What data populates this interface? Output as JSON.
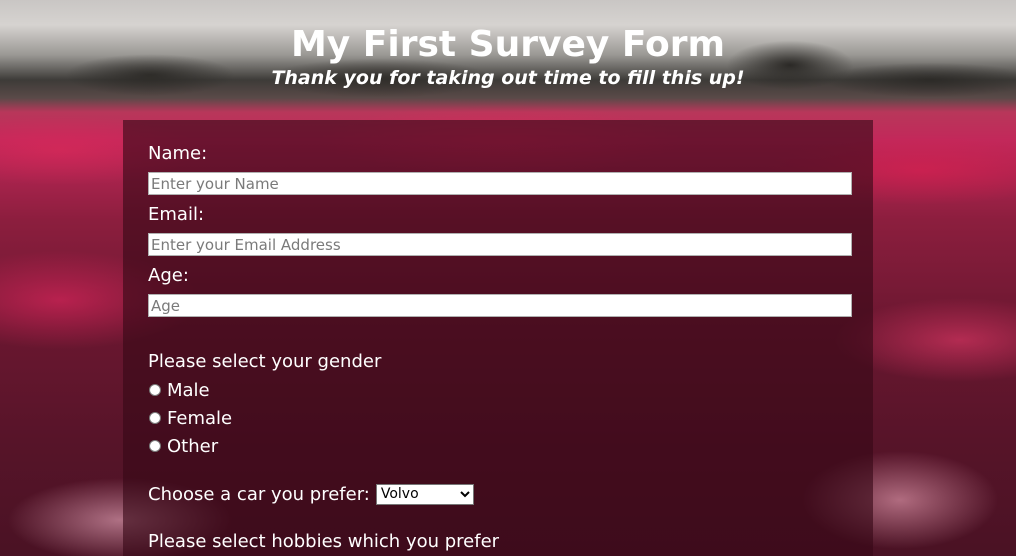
{
  "header": {
    "title": "My First Survey Form",
    "subtitle": "Thank you for taking out time to fill this up!"
  },
  "form": {
    "name": {
      "label": "Name:",
      "placeholder": "Enter your Name",
      "value": ""
    },
    "email": {
      "label": "Email:",
      "placeholder": "Enter your Email Address",
      "value": ""
    },
    "age": {
      "label": "Age:",
      "placeholder": "Age",
      "value": ""
    },
    "gender": {
      "label": "Please select your gender",
      "options": [
        "Male",
        "Female",
        "Other"
      ]
    },
    "car": {
      "label": "Choose a car you prefer:",
      "selected": "Volvo"
    },
    "hobbies": {
      "label": "Please select hobbies which you prefer"
    }
  }
}
